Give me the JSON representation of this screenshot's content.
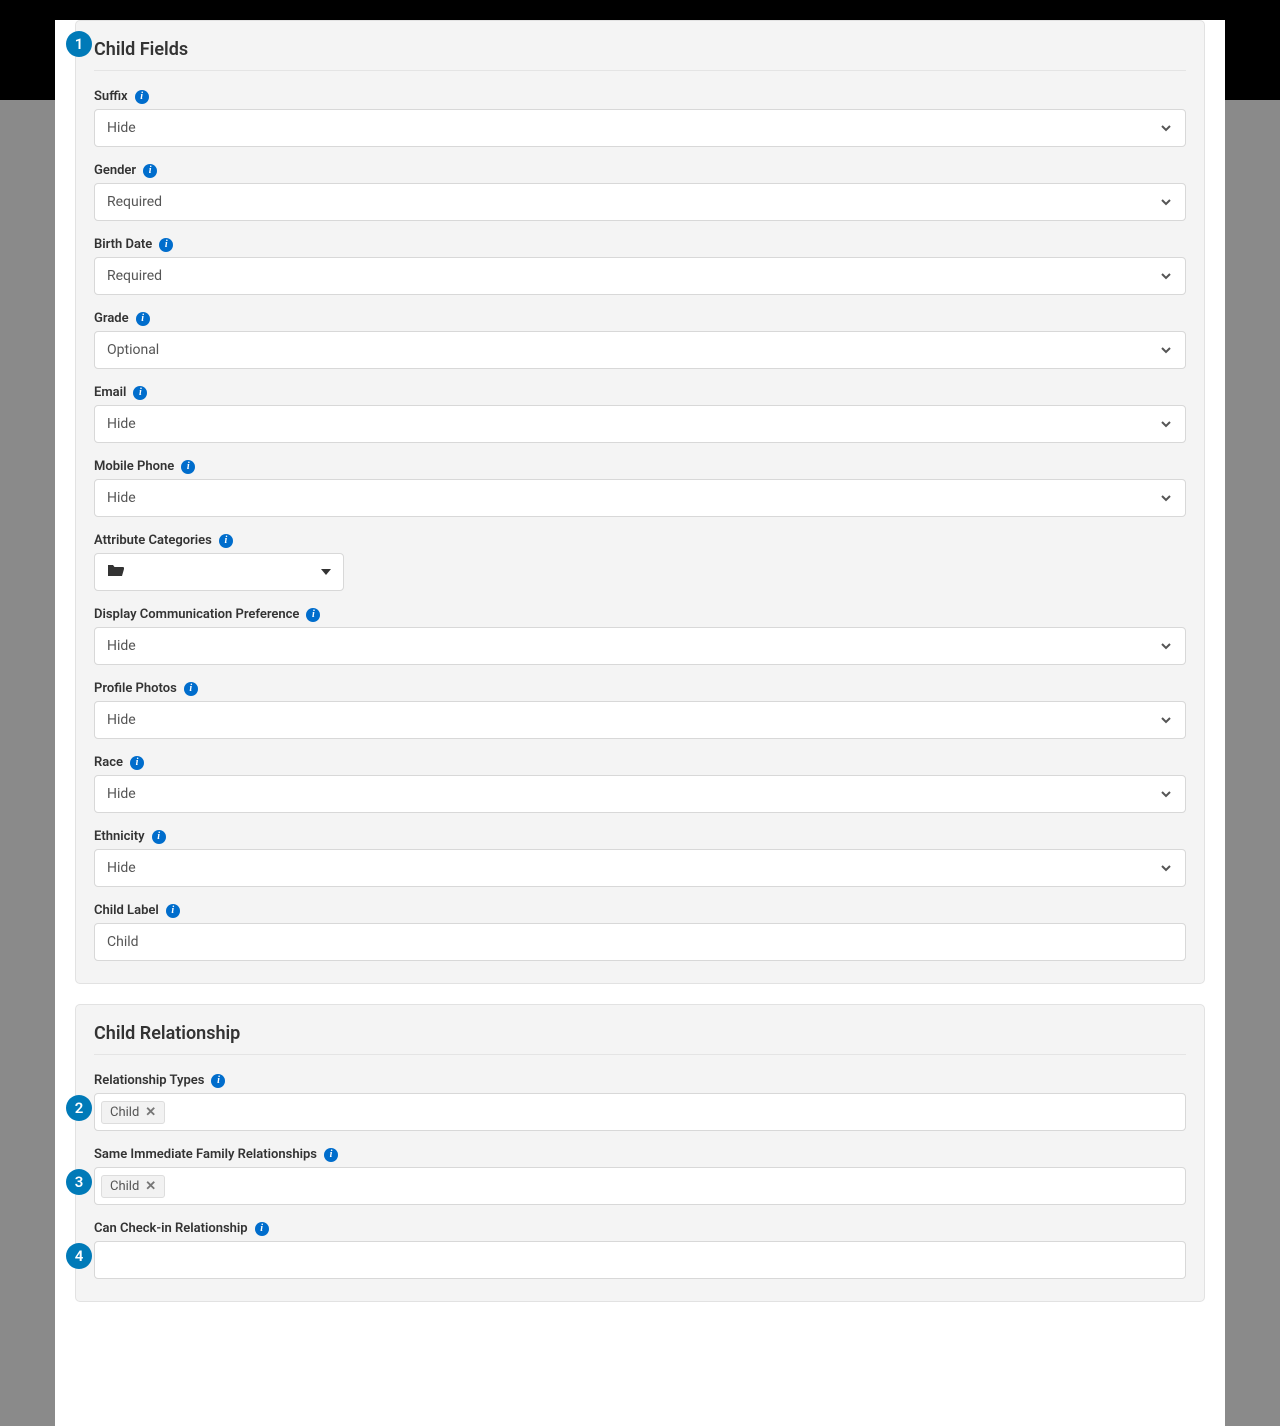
{
  "panels": {
    "childFields": {
      "title": "Child Fields",
      "marker": "1",
      "fields": {
        "suffix": {
          "label": "Suffix",
          "value": "Hide"
        },
        "gender": {
          "label": "Gender",
          "value": "Required"
        },
        "birthDate": {
          "label": "Birth Date",
          "value": "Required"
        },
        "grade": {
          "label": "Grade",
          "value": "Optional"
        },
        "email": {
          "label": "Email",
          "value": "Hide"
        },
        "mobilePhone": {
          "label": "Mobile Phone",
          "value": "Hide"
        },
        "attributeCategories": {
          "label": "Attribute Categories"
        },
        "displayCommPref": {
          "label": "Display Communication Preference",
          "value": "Hide"
        },
        "profilePhotos": {
          "label": "Profile Photos",
          "value": "Hide"
        },
        "race": {
          "label": "Race",
          "value": "Hide"
        },
        "ethnicity": {
          "label": "Ethnicity",
          "value": "Hide"
        },
        "childLabel": {
          "label": "Child Label",
          "value": "Child"
        }
      }
    },
    "childRelationship": {
      "title": "Child Relationship",
      "fields": {
        "relationshipTypes": {
          "label": "Relationship Types",
          "marker": "2",
          "tag": "Child"
        },
        "sameImmediate": {
          "label": "Same Immediate Family Relationships",
          "marker": "3",
          "tag": "Child"
        },
        "canCheckin": {
          "label": "Can Check-in Relationship",
          "marker": "4"
        }
      }
    }
  }
}
